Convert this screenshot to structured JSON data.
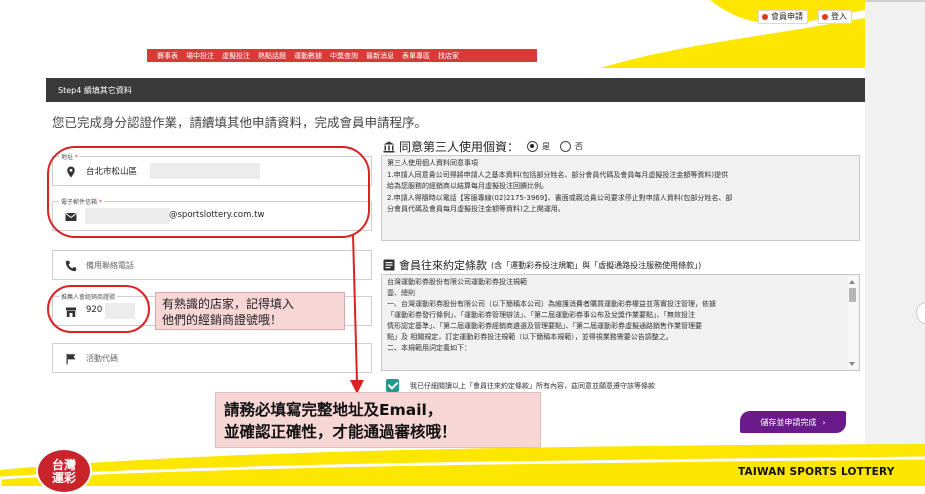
{
  "header": {
    "member_apply": "會員申請",
    "login": "登入",
    "nav": [
      "賽事表",
      "場中投注",
      "虛擬投注",
      "熱點話題",
      "運動數據",
      "中獎查詢",
      "最新消息",
      "表單專區",
      "找店家"
    ]
  },
  "step": {
    "title": "Step4 續填其它資料"
  },
  "intro": "您已完成身分認證作業，請續填其他申請資料，完成會員申請程序。",
  "form": {
    "address": {
      "label": "地址",
      "value": "台北市松山區"
    },
    "email": {
      "label": "電子郵件信箱",
      "value": "@sportslottery.com.tw"
    },
    "backup_phone": {
      "placeholder": "備用聯絡電話"
    },
    "store_id": {
      "label": "推薦人會經銷商證號",
      "value": "920"
    },
    "promo_code": {
      "placeholder": "活動代碼"
    }
  },
  "annotations": {
    "store_note_1": "有熟識的店家，記得填入",
    "store_note_2": "他們的經銷商證號哦！",
    "main_note_1": "請務必填寫完整地址及Email，",
    "main_note_2": "並確認正確性，才能通過審核哦！"
  },
  "consent": {
    "title": "同意第三人使用個資：",
    "yes": "是",
    "no": "否",
    "text": [
      "第三人使用個人資料同意事項",
      "1.申請人同意貴公司得將申請人之基本資料(包括部分姓名、部分會員代碼及會員每月虛擬投注金額等資料)提供",
      "給為您服務的經銷商以結算每月虛擬投注回饋比例。",
      "2.申請人得隨時以電話【客服專線(02)2175-3969】、書面或親洽貴公司要求停止對申請人資料(包部分姓名、部",
      "分會員代碼及會員每月虛擬投注金額等資料)之上開運用。"
    ]
  },
  "terms": {
    "title": "會員往來約定條款",
    "subtitle": "(含「運動彩券投注規範」與「虛擬通路投注服務使用條款」)",
    "text": [
      "台灣運動彩券股份有限公司運動彩券投注規範",
      "壹、總則",
      "一、台灣運動彩券股份有限公司（以下簡稱本公司）為維護消費者購買運動彩券權益並落實投注管理，依據",
      "「運動彩券發行條例」、「運動彩券管理辦法」、「第二屆運動彩券事公布及兌獎作業要點」、「無效投注",
      "情形認定基準」、「第二屆運動彩券經銷商遴選及管理要點」、「第二屆運動彩券虛擬通路銷售作業管理要",
      "點」及 相關規定，訂定運動彩券投注規範（以下簡稱本規範），並得視業務需要公告調整之。",
      "二、本規範用詞定義如下："
    ],
    "agree": "我已仔細閱讀以上「會員往來約定條款」所有內容，茲同意並願意遵守該等條款"
  },
  "submit": "儲存並申請完成",
  "footer": {
    "brand": "TAIWAN SPORTS LOTTERY",
    "logo_text_1": "台灣",
    "logo_text_2": "運彩"
  },
  "colors": {
    "yellow": "#fde600",
    "red": "#d83a3a",
    "purple": "#6a1a8a",
    "dark_bar": "#3a3a3a"
  }
}
